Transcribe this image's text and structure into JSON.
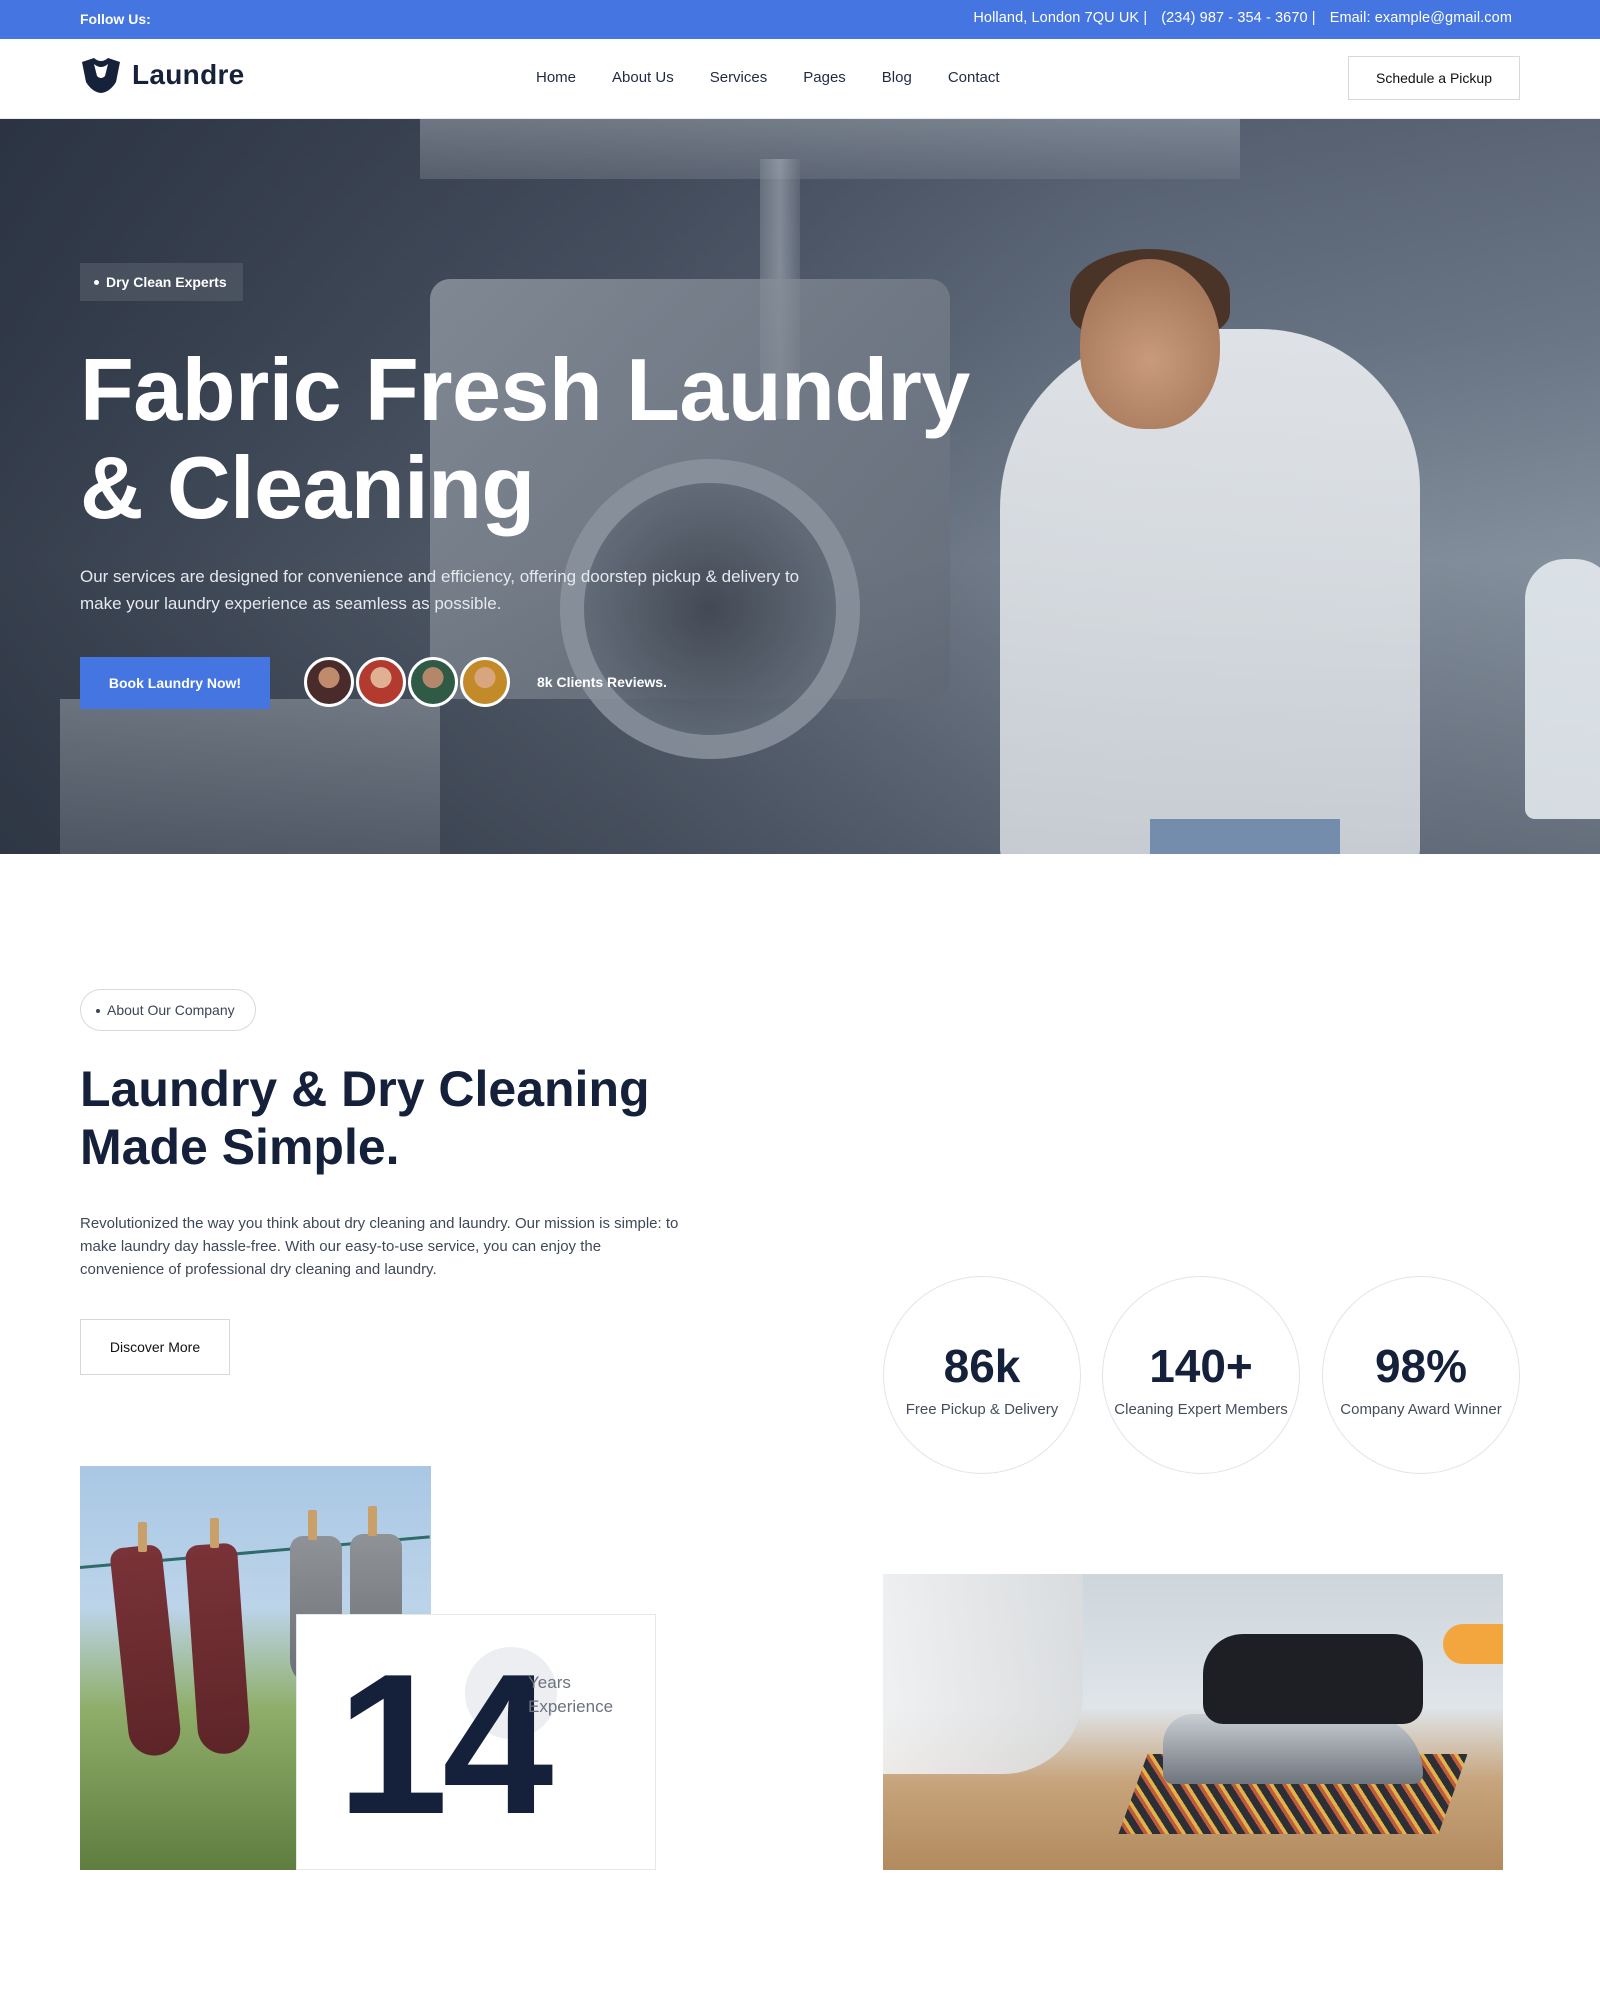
{
  "topbar": {
    "follow_label": "Follow Us:",
    "address": "Holland, London 7QU UK |",
    "phone": "(234) 987 - 354 - 3670 |",
    "email": "Email: example@gmail.com"
  },
  "header": {
    "logo_text": "Laundre",
    "nav": [
      "Home",
      "About Us",
      "Services",
      "Pages",
      "Blog",
      "Contact"
    ],
    "cta": "Schedule a Pickup"
  },
  "hero": {
    "badge": "Dry Clean Experts",
    "title_line1": "Fabric Fresh Laundry",
    "title_line2": "& Cleaning",
    "description": "Our services are designed for convenience and efficiency, offering doorstep pickup & delivery to make your laundry experience as seamless as possible.",
    "cta": "Book Laundry Now!",
    "reviews": "8k Clients Reviews."
  },
  "about": {
    "pill": "About Our Company",
    "title_line1": "Laundry & Dry Cleaning",
    "title_line2": "Made Simple.",
    "description": "Revolutionized the way you think about dry cleaning and laundry. Our mission is simple: to make laundry day hassle-free. With our easy-to-use service, you can enjoy the convenience of professional dry cleaning and laundry.",
    "cta": "Discover More",
    "stats": [
      {
        "value": "86k",
        "label": "Free Pickup & Delivery"
      },
      {
        "value": "140+",
        "label": "Cleaning Expert Members"
      },
      {
        "value": "98%",
        "label": "Company Award Winner"
      }
    ],
    "experience": {
      "number": "14",
      "line1": "Years",
      "line2": "Experience"
    }
  },
  "colors": {
    "accent": "#4575e0",
    "navy": "#15203a"
  }
}
